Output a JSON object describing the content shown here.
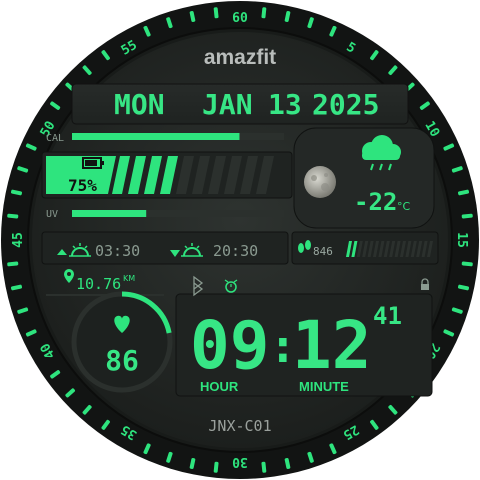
{
  "brand": "amazfit",
  "date": {
    "weekday": "MON",
    "month": "JAN",
    "day": "13",
    "year": "2025"
  },
  "calories": {
    "label": "CAL",
    "progress": 0.79
  },
  "battery": {
    "percent": "75%",
    "progress": 0.75
  },
  "uv": {
    "label": "UV",
    "progress": 0.35
  },
  "weather": {
    "temperature": "-22",
    "unit": "°C",
    "icon": "rain-cloud-icon",
    "moon_icon": "moon-icon"
  },
  "sun": {
    "sunrise": "03:30",
    "sunset": "20:30"
  },
  "steps": {
    "value": "846",
    "progress": 0.12
  },
  "distance": {
    "value": "10.76",
    "unit": "KM"
  },
  "heart_rate": {
    "value": "86",
    "progress": 0.22
  },
  "time": {
    "hours": "09",
    "minutes": "12",
    "seconds": "41",
    "hour_label": "HOUR",
    "minute_label": "MINUTE"
  },
  "model": "JNX-C01",
  "bezel": {
    "numbers": [
      "60",
      "5",
      "10",
      "15",
      "20",
      "25",
      "30",
      "35",
      "40",
      "45",
      "50",
      "55"
    ]
  },
  "colors": {
    "accent": "#2ee47e",
    "background": "#222624",
    "bezel": "#151716"
  }
}
